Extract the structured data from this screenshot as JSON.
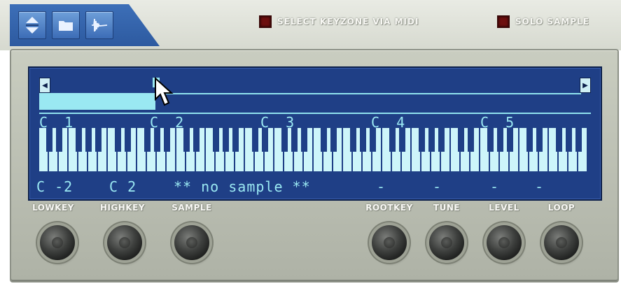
{
  "toolbar": {
    "buttons": [
      {
        "icon": "up-down-arrows-icon"
      },
      {
        "icon": "folder-icon"
      },
      {
        "icon": "waveform-icon"
      }
    ],
    "select_keyzone_label": "SELECT KEYZONE VIA MIDI",
    "solo_sample_label": "SOLO SAMPLE"
  },
  "display": {
    "octave_labels": [
      "C 1",
      "C 2",
      "C 3",
      "C 4",
      "C 5"
    ],
    "lowkey_value": "C -2",
    "highkey_value": "C 2",
    "sample_value": "** no sample **",
    "rootkey_value": "-",
    "tune_value": "-",
    "level_value": "-",
    "loop_value": "-"
  },
  "knobs": {
    "lowkey_label": "LOWKEY",
    "highkey_label": "HIGHKEY",
    "sample_label": "SAMPLE",
    "rootkey_label": "ROOTKEY",
    "tune_label": "TUNE",
    "level_label": "LEVEL",
    "loop_label": "LOOP"
  },
  "colors": {
    "screen_bg": "#1f3f86",
    "screen_fg": "#9ae8f2",
    "panel": "#bfc3b6",
    "led_off": "#6d0f0f"
  }
}
